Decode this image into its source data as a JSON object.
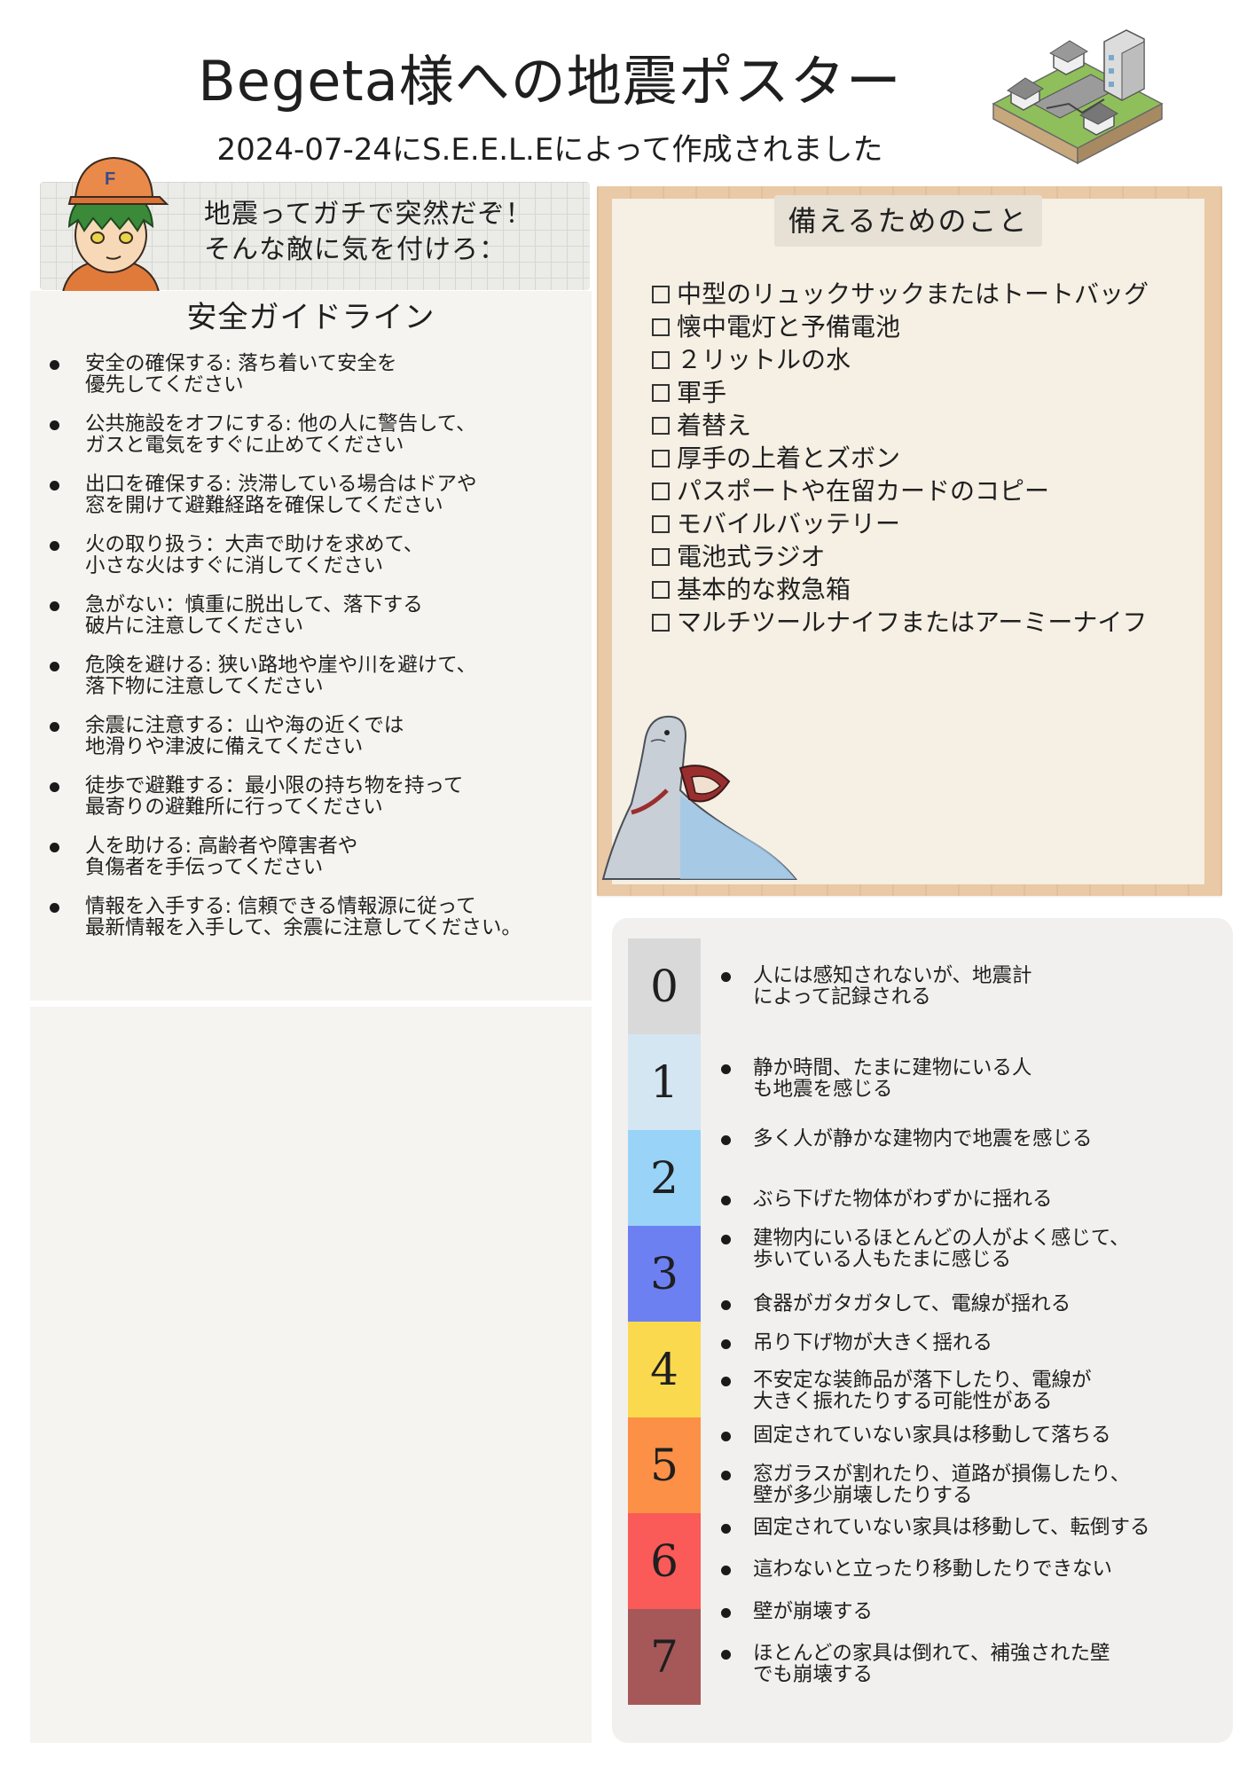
{
  "header": {
    "title": "Begeta様への地震ポスター",
    "subtitle": "2024-07-24にS.E.E.L.Eによって作成されました"
  },
  "speech": {
    "line1": "地震ってガチで突然だぞ！",
    "line2": "そんな敵に気を付けろ："
  },
  "guidelines": {
    "title": "安全ガイドライン",
    "items": [
      "安全の確保する: 落ち着いて安全を\n優先してください",
      "公共施設をオフにする: 他の人に警告して、\nガスと電気をすぐに止めてください",
      "出口を確保する: 渋滞している場合はドアや\n窓を開けて避難経路を確保してください",
      "火の取り扱う：大声で助けを求めて、\n小さな火はすぐに消してください",
      "急がない：慎重に脱出して、落下する\n破片に注意してください",
      "危険を避ける: 狭い路地や崖や川を避けて、\n落下物に注意してください",
      "余震に注意する：山や海の近くでは\n地滑りや津波に備えてください",
      "徒歩で避難する：最小限の持ち物を持って\n最寄りの避難所に行ってください",
      "人を助ける: 高齢者や障害者や\n負傷者を手伝ってください",
      "情報を入手する: 信頼できる情報源に従って\n最新情報を入手して、余震に注意してください。"
    ]
  },
  "preparation": {
    "title": "備えるためのこと",
    "items": [
      "中型のリュックサックまたはトートバッグ",
      "懐中電灯と予備電池",
      "２リットルの水",
      "軍手",
      "着替え",
      "厚手の上着とズボン",
      "パスポートや在留カードのコピー",
      "モバイルバッテリー",
      "電池式ラジオ",
      "基本的な救急箱",
      "マルチツールナイフまたはアーミーナイフ"
    ]
  },
  "scale": {
    "levels": [
      {
        "level": "0",
        "color": "#d9d9d9",
        "items": [
          "人には感知されないが、地震計\nによって記録される"
        ]
      },
      {
        "level": "1",
        "color": "#d3e6f1",
        "items": [
          "静か時間、たまに建物にいる人\nも地震を感じる"
        ]
      },
      {
        "level": "2",
        "color": "#99d3f7",
        "items": [
          "多く人が静かな建物内で地震を感じる",
          "ぶら下げた物体がわずかに揺れる"
        ]
      },
      {
        "level": "3",
        "color": "#6c80f2",
        "items": [
          "建物内にいるほとんどの人がよく感じて、\n歩いている人もたまに感じる",
          "食器がガタガタして、電線が揺れる"
        ]
      },
      {
        "level": "4",
        "color": "#fbd94f",
        "items": [
          "吊り下げ物が大きく揺れる",
          "不安定な装飾品が落下したり、電線が\n大きく振れたりする可能性がある"
        ]
      },
      {
        "level": "5",
        "color": "#fc9046",
        "items": [
          "固定されていない家具は移動して落ちる",
          "窓ガラスが割れたり、道路が損傷したり、\n壁が多少崩壊したりする"
        ]
      },
      {
        "level": "6",
        "color": "#fa5a58",
        "items": [
          "固定されていない家具は移動して、転倒する",
          "這わないと立ったり移動したりできない"
        ]
      },
      {
        "level": "7",
        "color": "#a65858",
        "items": [
          "壁が崩壊する",
          "ほとんどの家具は倒れて、補強された壁\nでも崩壊する"
        ]
      }
    ]
  },
  "icons": {
    "town": "isometric-town-icon",
    "avatar": "boy-avatar-icon",
    "seal": "seal-with-bag-icon"
  }
}
